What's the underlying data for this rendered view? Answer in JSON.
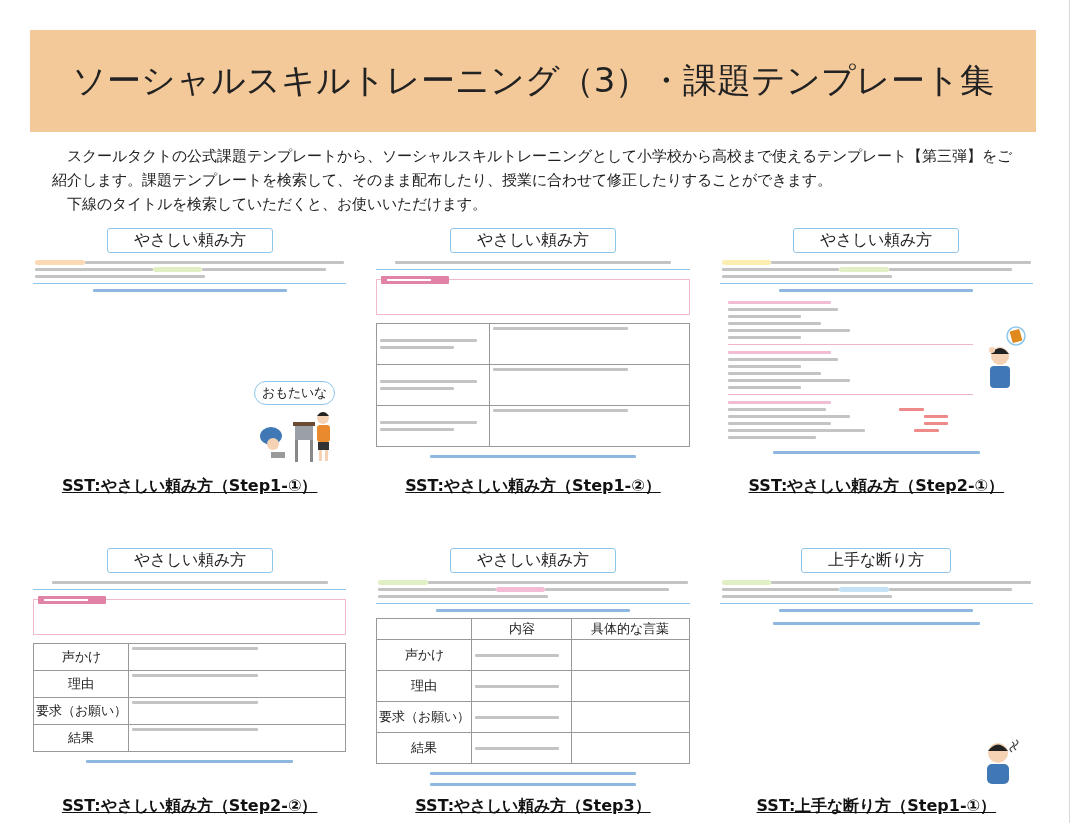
{
  "page_title": "ソーシャルスキルトレーニング（3）・課題テンプレート集",
  "intro": [
    "　スクールタクトの公式課題テンプレートから、ソーシャルスキルトレーニングとして小学校から高校まで使えるテンプレート【第三弾】をご紹介します。課題テンプレートを検索して、そのまま配布したり、授業に合わせて修正したりすることができます。",
    "　下線のタイトルを検索していただくと、お使いいただけます。"
  ],
  "templates": [
    {
      "caption": "SST:やさしい頼み方（Step1-①）",
      "blocks": [
        {
          "kind": "heading",
          "text": "やさしい頼み方"
        },
        {
          "kind": "story",
          "highlights": [
            {
              "color": "#fbd9b5"
            },
            {
              "color": "#e1efc4"
            }
          ]
        },
        {
          "kind": "prompt"
        },
        {
          "kind": "desk_scene",
          "speech": "おもたいな"
        }
      ]
    },
    {
      "caption": "SST:やさしい頼み方（Step1-②）",
      "blocks": [
        {
          "kind": "heading",
          "text": "やさしい頼み方"
        },
        {
          "kind": "instruction"
        },
        {
          "kind": "note_box"
        },
        {
          "kind": "example_table"
        },
        {
          "kind": "footnote"
        }
      ]
    },
    {
      "caption": "SST:やさしい頼み方（Step2-①）",
      "blocks": [
        {
          "kind": "heading",
          "text": "やさしい頼み方"
        },
        {
          "kind": "story",
          "highlights": [
            {
              "color": "#fbeeb0"
            },
            {
              "color": "#e1efc4"
            }
          ]
        },
        {
          "kind": "prompt"
        },
        {
          "kind": "pattern"
        },
        {
          "kind": "pattern"
        },
        {
          "kind": "tagged_pattern"
        },
        {
          "kind": "footnote"
        },
        {
          "kind": "book_thought"
        }
      ]
    },
    {
      "caption": "SST:やさしい頼み方（Step2-②）",
      "blocks": [
        {
          "kind": "heading",
          "text": "やさしい頼み方"
        },
        {
          "kind": "instruction"
        },
        {
          "kind": "note_box"
        },
        {
          "kind": "label_table",
          "rows": [
            "声かけ",
            "理由",
            "要求（お願い）",
            "結果"
          ]
        },
        {
          "kind": "footnote"
        }
      ]
    },
    {
      "caption": "SST:やさしい頼み方（Step3）",
      "blocks": [
        {
          "kind": "heading",
          "text": "やさしい頼み方"
        },
        {
          "kind": "story",
          "highlights": [
            {
              "color": "#e1efc4"
            },
            {
              "color": "#f4bcd6"
            }
          ]
        },
        {
          "kind": "prompt"
        },
        {
          "kind": "label_table",
          "header": [
            "内容",
            "具体的な言葉"
          ],
          "rows": [
            "声かけ",
            "理由",
            "要求（お願い）",
            "結果"
          ]
        },
        {
          "kind": "footnote"
        },
        {
          "kind": "footnote"
        }
      ]
    },
    {
      "caption": "SST:上手な断り方（Step1-①）",
      "blocks": [
        {
          "kind": "heading",
          "text": "上手な断り方"
        },
        {
          "kind": "story",
          "highlights": [
            {
              "color": "#e1efc4"
            },
            {
              "color": "#c4e2f6"
            }
          ]
        },
        {
          "kind": "prompt"
        },
        {
          "kind": "worried_boy"
        },
        {
          "kind": "footnote"
        }
      ]
    }
  ]
}
